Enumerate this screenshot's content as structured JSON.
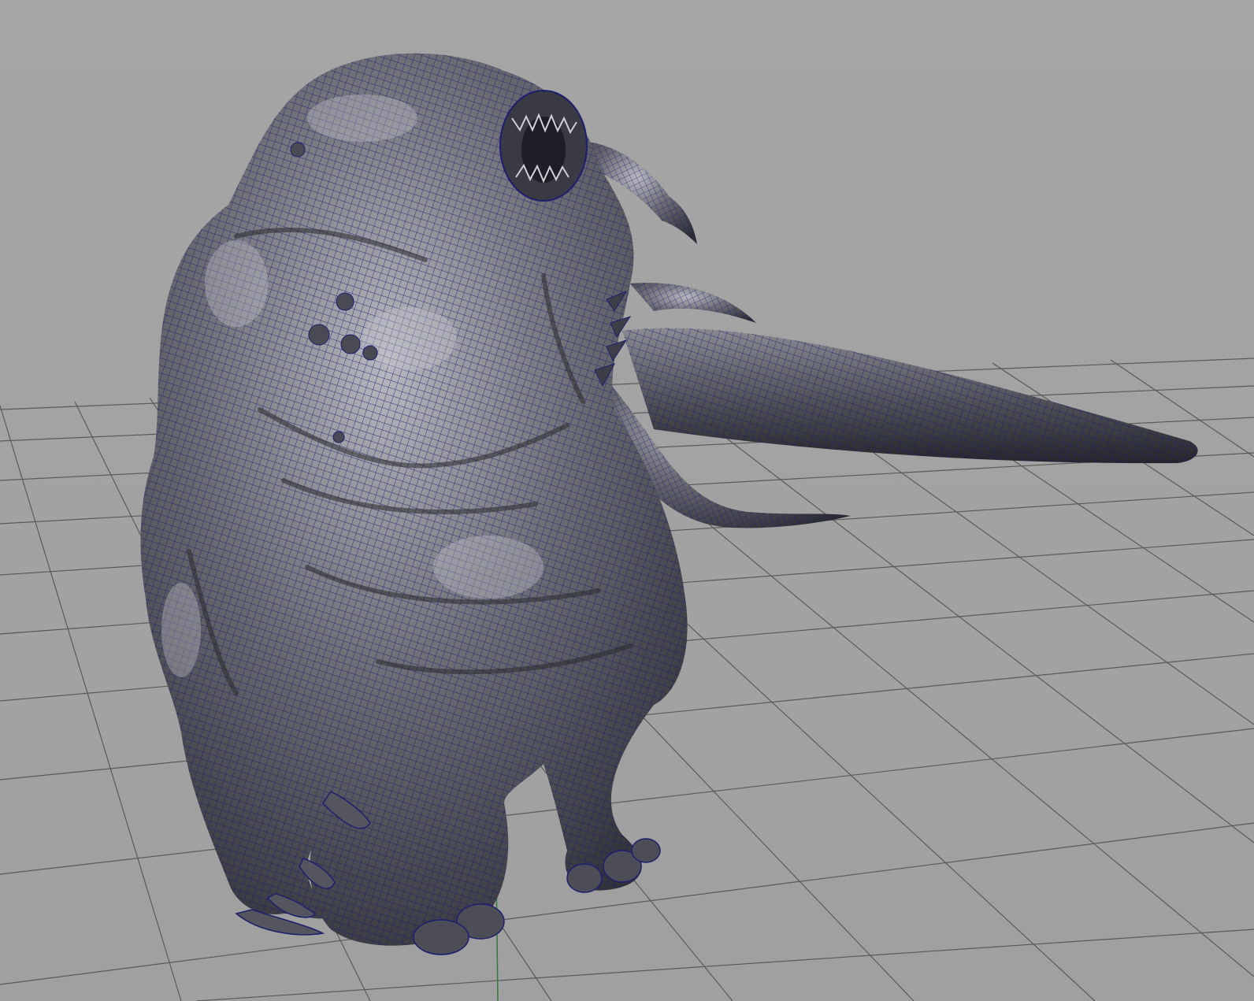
{
  "viewport": {
    "background_color": "#a3a3a3",
    "grid_color": "#585858",
    "grid_axis_color": "#2f7a3d",
    "wireframe_color": "#1c1f6e",
    "mesh_shading_color": "#5a5a62",
    "mesh_highlight_color": "#b9b9c2",
    "mesh_shadow_color": "#2a2a30"
  },
  "scene": {
    "object_icon": "mesh-object-icon",
    "display_mode": "wireframe-on-shaded"
  }
}
